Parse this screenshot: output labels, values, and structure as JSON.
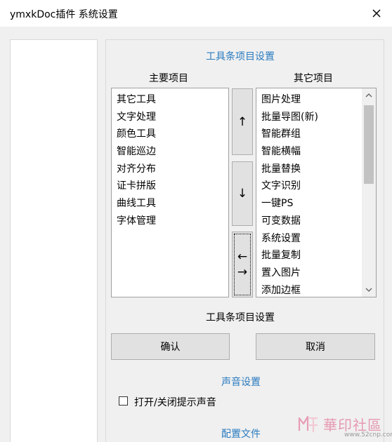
{
  "window": {
    "title": "ymxkDoc插件 系统设置",
    "close_glyph": "×"
  },
  "toolbar_settings": {
    "section_title": "工具条项目设置",
    "main_header": "主要项目",
    "other_header": "其它项目",
    "main_items": [
      "其它工具",
      "文字处理",
      "颜色工具",
      "智能巡边",
      "对齐分布",
      "证卡拼版",
      "曲线工具",
      "字体管理"
    ],
    "other_items": [
      "图片处理",
      "批量导图(新)",
      "智能群组",
      "智能横幅",
      "批量替换",
      "文字识别",
      "一键PS",
      "可变数据",
      "系统设置",
      "批量复制",
      "置入图片",
      "添加边框"
    ],
    "move_up_glyph": "↑",
    "move_down_glyph": "↓",
    "swap_glyph_left": "←",
    "swap_glyph_right": "→",
    "footer_label": "工具条项目设置",
    "confirm_label": "确认",
    "cancel_label": "取消"
  },
  "sound_settings": {
    "section_title": "声音设置",
    "toggle_label": "打开/关闭提示声音",
    "toggle_checked": false
  },
  "config_file": {
    "section_title": "配置文件"
  },
  "watermark": {
    "name": "華印社區",
    "url": "www.52cnp.com"
  },
  "colors": {
    "accent": "#2a7bc0",
    "window_bg": "#f0f0f0",
    "button_bg": "#e1e1e1",
    "watermark": "#e58aa6"
  }
}
